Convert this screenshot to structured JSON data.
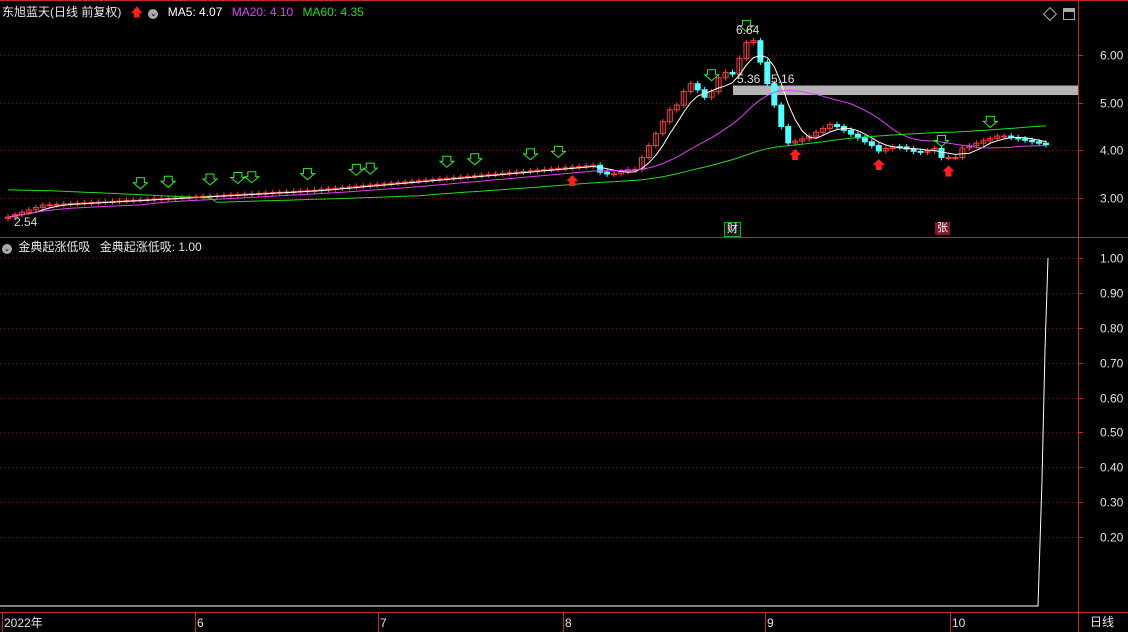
{
  "header": {
    "stock_title": "东旭蓝天(日线 前复权)",
    "ma5": "MA5: 4.07",
    "ma20": "MA20: 4.10",
    "ma60": "MA60: 4.35"
  },
  "indicator": {
    "name": "金典起涨低吸",
    "value_label": "金典起涨低吸: 1.00"
  },
  "annotations": {
    "high_label": "6.64",
    "low_label": "2.54",
    "range_label": "5.36 - 5.16"
  },
  "event_tags": {
    "finance": "财",
    "limit": "张"
  },
  "bottom_bar": {
    "period_button": "日线",
    "date_labels": [
      "2022年",
      "6",
      "7",
      "8",
      "9",
      "10"
    ]
  },
  "price_axis": {
    "ticks": [
      "6.00",
      "5.00",
      "4.00",
      "3.00"
    ]
  },
  "indicator_axis": {
    "ticks": [
      "1.00",
      "0.90",
      "0.80",
      "0.70",
      "0.60",
      "0.50",
      "0.40",
      "0.30",
      "0.20"
    ]
  },
  "colors": {
    "background": "#000000",
    "frame": "#c0282e",
    "up": "#ff3c3c",
    "down": "#54ffff",
    "ma5": "#ffffff",
    "ma20": "#e040fb",
    "ma60": "#22dd22",
    "signal_down": "#33ee33",
    "signal_up": "#ff2020",
    "resistance_band": "#b4b4b4"
  },
  "chart_data": [
    {
      "type": "candlestick",
      "title": "东旭蓝天(日线 前复权)",
      "y_ticks": [
        3.0,
        4.0,
        5.0,
        6.0
      ],
      "ylim": [
        2.4,
        6.9
      ],
      "x_ticks": [
        "2022年",
        "6",
        "7",
        "8",
        "9",
        "10"
      ],
      "marked_high": 6.64,
      "marked_low": 2.54,
      "band": [
        5.36,
        5.16
      ],
      "series": [
        {
          "name": "MA5",
          "last": 4.07
        },
        {
          "name": "MA20",
          "last": 4.1
        },
        {
          "name": "MA60",
          "last": 4.35
        }
      ]
    },
    {
      "type": "line",
      "title": "金典起涨低吸",
      "y_ticks": [
        0.2,
        0.3,
        0.4,
        0.5,
        0.6,
        0.7,
        0.8,
        0.9,
        1.0
      ],
      "ylim": [
        0.0,
        1.0
      ],
      "last_value": 1.0
    }
  ]
}
